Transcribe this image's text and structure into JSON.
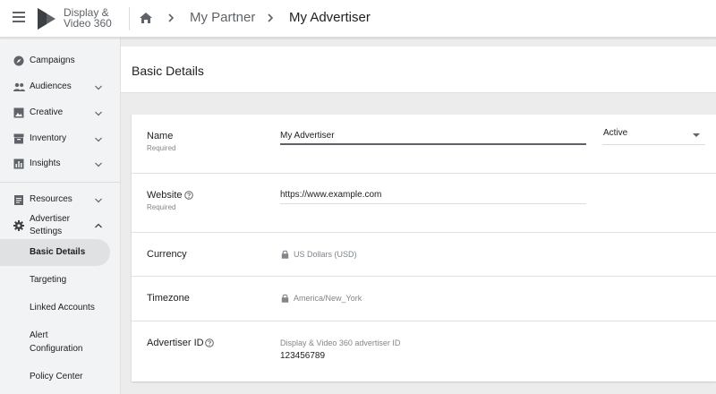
{
  "app": {
    "name_line1": "Display &",
    "name_line2": "Video 360"
  },
  "breadcrumb": {
    "partner": "My Partner",
    "advertiser": "My Advertiser"
  },
  "sidebar": {
    "items": [
      {
        "label": "Campaigns",
        "icon": "compass-icon"
      },
      {
        "label": "Audiences",
        "icon": "people-icon"
      },
      {
        "label": "Creative",
        "icon": "image-icon"
      },
      {
        "label": "Inventory",
        "icon": "inventory-icon"
      },
      {
        "label": "Insights",
        "icon": "bar-chart-icon"
      },
      {
        "label": "Resources",
        "icon": "clipboard-icon"
      },
      {
        "label_line1": "Advertiser",
        "label_line2": "Settings",
        "icon": "gear-icon"
      }
    ],
    "sub_items": [
      {
        "label": "Basic Details"
      },
      {
        "label": "Targeting"
      },
      {
        "label": "Linked Accounts"
      },
      {
        "label_line1": "Alert",
        "label_line2": "Configuration"
      },
      {
        "label": "Policy Center"
      }
    ]
  },
  "page": {
    "title": "Basic Details"
  },
  "form": {
    "name": {
      "label": "Name",
      "sub": "Required",
      "value": "My Advertiser",
      "status": "Active"
    },
    "website": {
      "label": "Website",
      "sub": "Required",
      "value": "https://www.example.com"
    },
    "currency": {
      "label": "Currency",
      "value": "US Dollars (USD)"
    },
    "timezone": {
      "label": "Timezone",
      "value": "America/New_York"
    },
    "advertiser_id": {
      "label": "Advertiser ID",
      "caption": "Display & Video 360 advertiser ID",
      "value": "123456789"
    }
  },
  "colors": {
    "text": "#202124",
    "muted": "#5f6368",
    "sidebar_bg": "#f1f3f4",
    "active_bg": "#e0e1e3"
  }
}
